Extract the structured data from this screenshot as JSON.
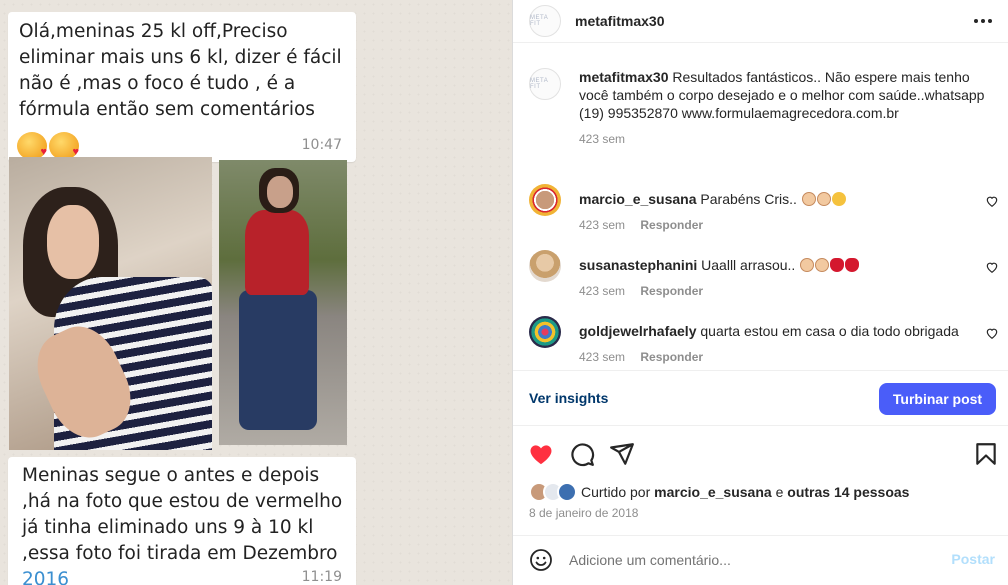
{
  "post_image": {
    "top_message": "Olá,meninas 25 kl off,Preciso eliminar mais uns 6 kl, dizer é fácil não é ,mas o foco é tudo , é a fórmula então sem comentários",
    "top_time": "10:47",
    "bottom_message": "Meninas segue o antes e depois ,há na foto que estou de vermelho já tinha eliminado uns 9 à 10 kl ,essa foto foi tirada em Dezembro",
    "bottom_message_year": "2016",
    "bottom_time": "11:19",
    "emojis": [
      "face-blowing-kiss-icon",
      "face-blowing-kiss-icon"
    ]
  },
  "header": {
    "username": "metafitmax30",
    "avatar_text": "META FIT"
  },
  "caption": {
    "username": "metafitmax30",
    "text": "Resultados fantásticos.. Não espere mais tenho você também o corpo desejado e o melhor com saúde..whatsapp (19) 995352870 www.formulaemagrecedora.com.br",
    "age": "423 sem"
  },
  "comments": [
    {
      "username": "marcio_e_susana",
      "text": "Parabéns Cris..",
      "emojis": [
        "clap",
        "clap",
        "heart-eyes"
      ],
      "age": "423 sem",
      "reply_label": "Responder"
    },
    {
      "username": "susanastephanini",
      "text": "Uaalll arrasou..",
      "emojis": [
        "clap",
        "clap",
        "lips",
        "lips"
      ],
      "age": "423 sem",
      "reply_label": "Responder"
    },
    {
      "username": "goldjewelrhafaely",
      "text": "quarta estou em casa o dia todo obrigada",
      "emojis": [],
      "age": "423 sem",
      "reply_label": "Responder"
    }
  ],
  "insights": {
    "link_label": "Ver insights",
    "boost_label": "Turbinar post",
    "boost_color": "#4a5df9"
  },
  "actions": {
    "like_icon": "heart-filled-icon",
    "comment_icon": "comment-icon",
    "share_icon": "send-icon",
    "save_icon": "bookmark-icon",
    "like_color": "#ff3040"
  },
  "likes": {
    "prefix": "Curtido por",
    "first_user": "marcio_e_susana",
    "connector": "e",
    "others": "outras 14 pessoas"
  },
  "post_date": "8 de janeiro de 2018",
  "comment_box": {
    "placeholder": "Adicione um comentário...",
    "post_label": "Postar"
  }
}
